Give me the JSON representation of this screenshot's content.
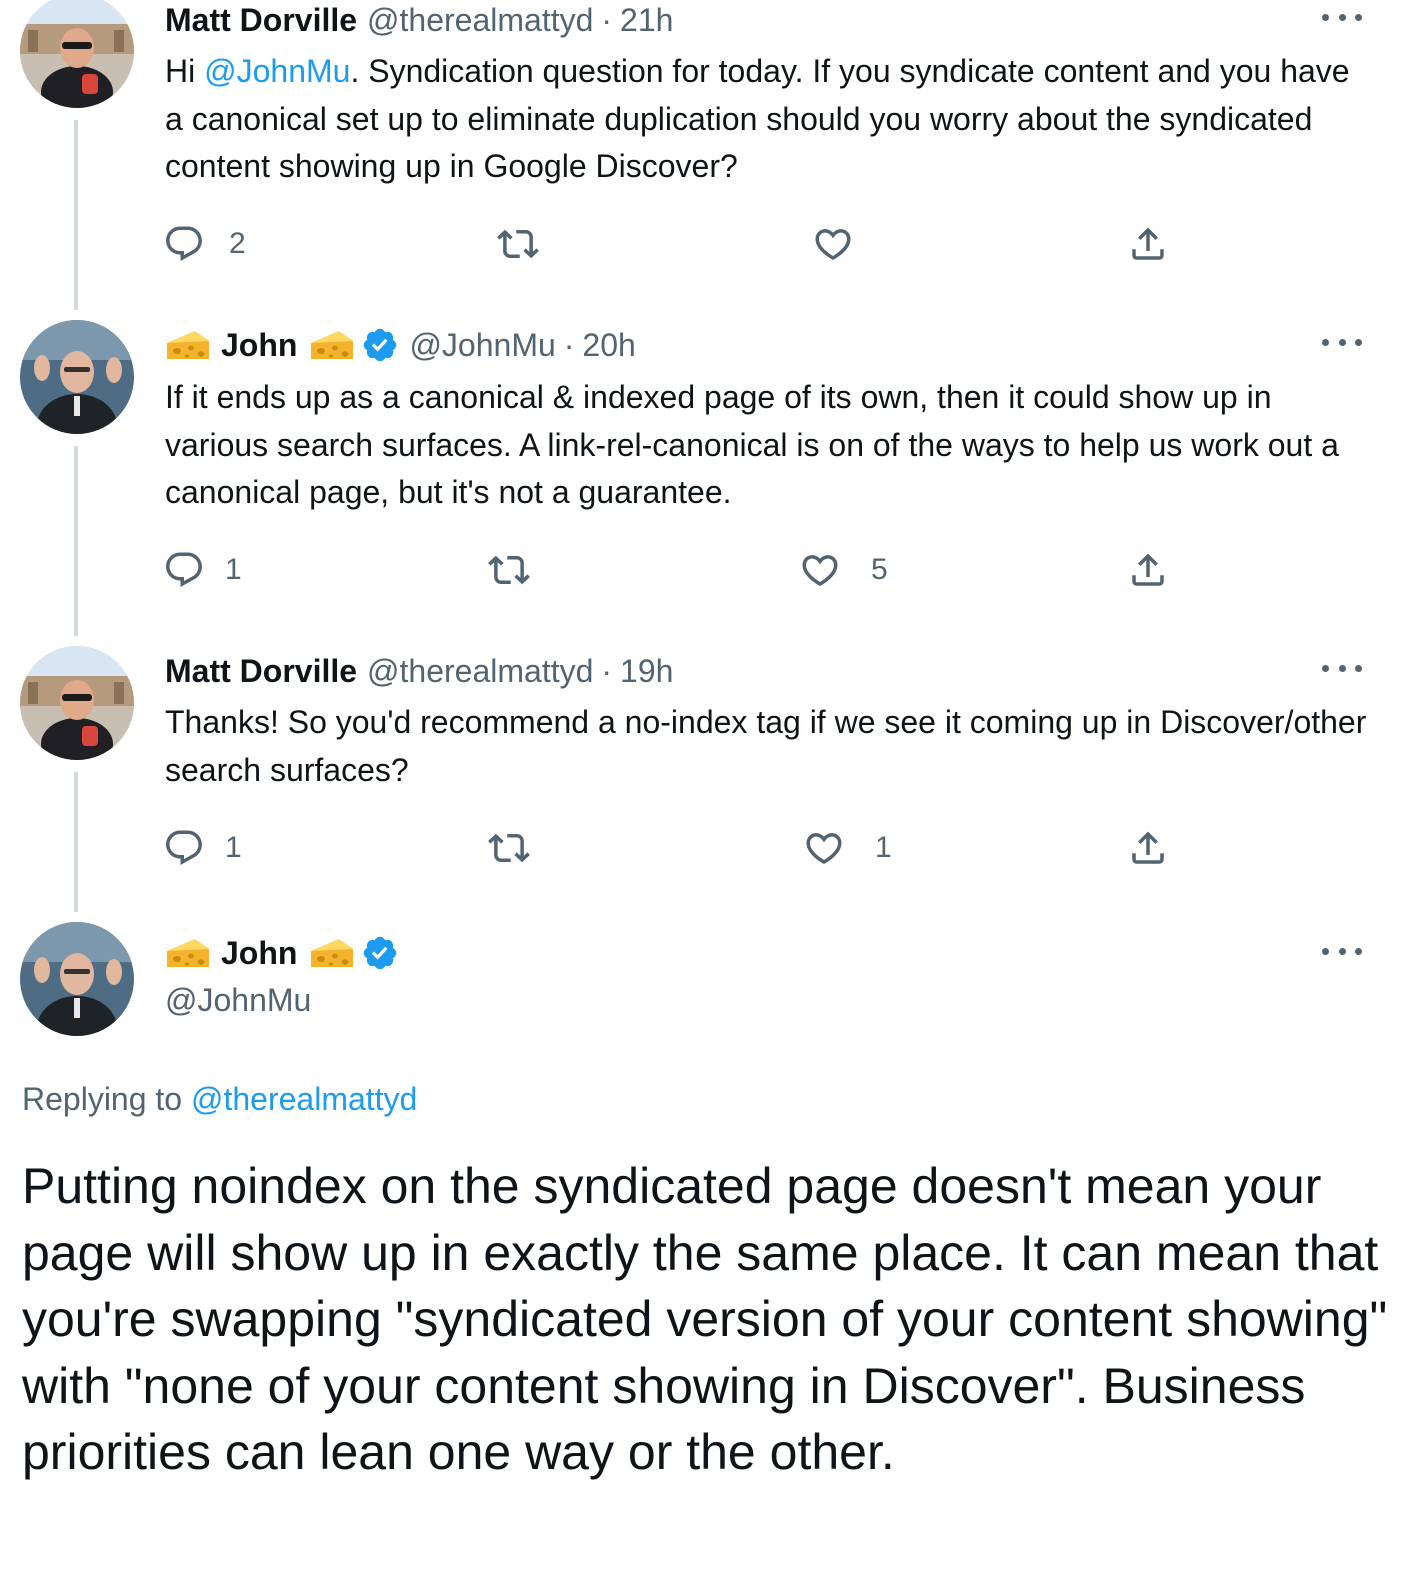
{
  "tweets": [
    {
      "name": "Matt Dorville",
      "handle": "@therealmattyd",
      "separator": "·",
      "time": "21h",
      "text_parts": [
        "Hi ",
        "@JohnMu",
        ". Syndication question for today. If you syndicate content and you have a canonical set up to eliminate duplication should you worry about the syndicated content showing up in Google Discover?"
      ],
      "replies": "2",
      "retweets": "",
      "likes": ""
    },
    {
      "name": "John",
      "handle": "@JohnMu",
      "separator": "·",
      "time": "20h",
      "text": "If it ends up as a canonical & indexed page of its own, then it could show up in various search surfaces. A link-rel-canonical is on of the ways to help us work out a canonical page, but it's not a guarantee.",
      "replies": "1",
      "retweets": "",
      "likes": "5"
    },
    {
      "name": "Matt Dorville",
      "handle": "@therealmattyd",
      "separator": "·",
      "time": "19h",
      "text": "Thanks! So you'd recommend a no-index tag if we see it coming up in Discover/other search surfaces?",
      "replies": "1",
      "retweets": "",
      "likes": "1"
    }
  ],
  "main_tweet": {
    "name": "John",
    "handle": "@JohnMu",
    "replying_prefix": "Replying to ",
    "replying_to": "@therealmattyd",
    "text": "Putting noindex on the syndicated page doesn't mean your page will show up in exactly the same place. It can mean that you're swapping \"syndicated version of your content showing\" with \"none of your content showing in Discover\". Business priorities can lean one way or the other."
  },
  "icons": {
    "reply": "reply-icon",
    "retweet": "retweet-icon",
    "like": "heart-icon",
    "share": "share-icon",
    "more": "more-icon",
    "verified": "verified-badge-icon",
    "emoji": "cheese-emoji-icon"
  },
  "colors": {
    "text": "#0f1419",
    "secondary": "#536471",
    "link": "#1d9bf0",
    "thread_line": "#cfd9de"
  }
}
